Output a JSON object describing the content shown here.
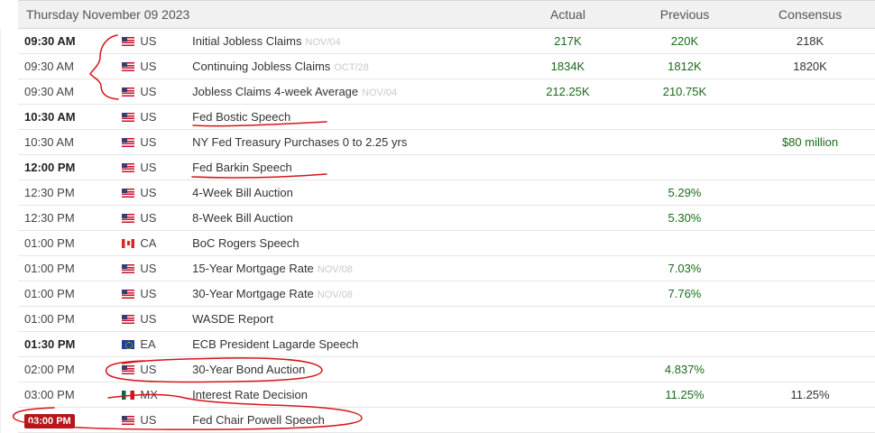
{
  "header": {
    "date": "Thursday November 09 2023",
    "col_actual": "Actual",
    "col_previous": "Previous",
    "col_consensus": "Consensus"
  },
  "rows": [
    {
      "time": "09:30 AM",
      "bold": true,
      "country": "US",
      "flag": "us-flag-icon",
      "event": "Initial Jobless Claims",
      "period": "NOV/04",
      "actual": "217K",
      "previous": "220K",
      "consensus": "218K"
    },
    {
      "time": "09:30 AM",
      "bold": false,
      "country": "US",
      "flag": "us-flag-icon",
      "event": "Continuing Jobless Claims",
      "period": "OCT/28",
      "actual": "1834K",
      "previous": "1812K",
      "consensus": "1820K"
    },
    {
      "time": "09:30 AM",
      "bold": false,
      "country": "US",
      "flag": "us-flag-icon",
      "event": "Jobless Claims 4-week Average",
      "period": "NOV/04",
      "actual": "212.25K",
      "previous": "210.75K",
      "consensus": ""
    },
    {
      "time": "10:30 AM",
      "bold": true,
      "country": "US",
      "flag": "us-flag-icon",
      "event": "Fed Bostic Speech",
      "period": "",
      "actual": "",
      "previous": "",
      "consensus": ""
    },
    {
      "time": "10:30 AM",
      "bold": false,
      "country": "US",
      "flag": "us-flag-icon",
      "event": "NY Fed Treasury Purchases 0 to 2.25 yrs",
      "period": "",
      "actual": "",
      "previous": "",
      "consensus": "$80 million"
    },
    {
      "time": "12:00 PM",
      "bold": true,
      "country": "US",
      "flag": "us-flag-icon",
      "event": "Fed Barkin Speech",
      "period": "",
      "actual": "",
      "previous": "",
      "consensus": ""
    },
    {
      "time": "12:30 PM",
      "bold": false,
      "country": "US",
      "flag": "us-flag-icon",
      "event": "4-Week Bill Auction",
      "period": "",
      "actual": "",
      "previous": "5.29%",
      "consensus": ""
    },
    {
      "time": "12:30 PM",
      "bold": false,
      "country": "US",
      "flag": "us-flag-icon",
      "event": "8-Week Bill Auction",
      "period": "",
      "actual": "",
      "previous": "5.30%",
      "consensus": ""
    },
    {
      "time": "01:00 PM",
      "bold": false,
      "country": "CA",
      "flag": "ca-flag-icon",
      "event": "BoC Rogers Speech",
      "period": "",
      "actual": "",
      "previous": "",
      "consensus": ""
    },
    {
      "time": "01:00 PM",
      "bold": false,
      "country": "US",
      "flag": "us-flag-icon",
      "event": "15-Year Mortgage Rate",
      "period": "NOV/08",
      "actual": "",
      "previous": "7.03%",
      "consensus": ""
    },
    {
      "time": "01:00 PM",
      "bold": false,
      "country": "US",
      "flag": "us-flag-icon",
      "event": "30-Year Mortgage Rate",
      "period": "NOV/08",
      "actual": "",
      "previous": "7.76%",
      "consensus": ""
    },
    {
      "time": "01:00 PM",
      "bold": false,
      "country": "US",
      "flag": "us-flag-icon",
      "event": "WASDE Report",
      "period": "",
      "actual": "",
      "previous": "",
      "consensus": ""
    },
    {
      "time": "01:30 PM",
      "bold": true,
      "country": "EA",
      "flag": "ea-flag-icon",
      "event": "ECB President Lagarde Speech",
      "period": "",
      "actual": "",
      "previous": "",
      "consensus": ""
    },
    {
      "time": "02:00 PM",
      "bold": false,
      "country": "US",
      "flag": "us-flag-icon",
      "event": "30-Year Bond Auction",
      "period": "",
      "actual": "",
      "previous": "4.837%",
      "consensus": ""
    },
    {
      "time": "03:00 PM",
      "bold": false,
      "country": "MX",
      "flag": "mx-flag-icon",
      "event": "Interest Rate Decision",
      "period": "",
      "actual": "",
      "previous": "11.25%",
      "consensus": "11.25%"
    },
    {
      "time": "03:00 PM",
      "bold": true,
      "badge": true,
      "country": "US",
      "flag": "us-flag-icon",
      "event": "Fed Chair Powell Speech",
      "period": "",
      "actual": "",
      "previous": "",
      "consensus": ""
    }
  ],
  "colors": {
    "value_green": "#1a6b1a",
    "annotation_red": "#d7141a",
    "badge_red": "#b3161b",
    "header_bg": "#f1f1f1"
  }
}
